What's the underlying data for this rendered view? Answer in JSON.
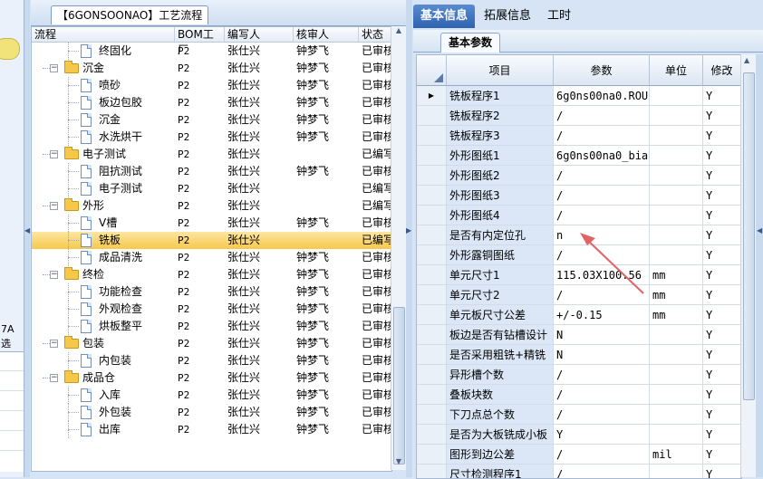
{
  "left_strip": {
    "labels": [
      "7A",
      "选"
    ]
  },
  "tree_panel": {
    "tab_title": "【6GONSOONAO】工艺流程",
    "columns": [
      "流程",
      "BOM工厂",
      "编写人",
      "核审人",
      "状态"
    ],
    "rows": [
      {
        "level": 2,
        "kind": "item",
        "name": "终固化",
        "bom": "P2",
        "writer": "张仕兴",
        "reviewer": "钟梦飞",
        "status": "已审核"
      },
      {
        "level": 1,
        "kind": "folder",
        "name": "沉金",
        "bom": "P2",
        "writer": "张仕兴",
        "reviewer": "钟梦飞",
        "status": "已审核"
      },
      {
        "level": 2,
        "kind": "item",
        "name": "喷砂",
        "bom": "P2",
        "writer": "张仕兴",
        "reviewer": "钟梦飞",
        "status": "已审核"
      },
      {
        "level": 2,
        "kind": "item",
        "name": "板边包胶",
        "bom": "P2",
        "writer": "张仕兴",
        "reviewer": "钟梦飞",
        "status": "已审核"
      },
      {
        "level": 2,
        "kind": "item",
        "name": "沉金",
        "bom": "P2",
        "writer": "张仕兴",
        "reviewer": "钟梦飞",
        "status": "已审核"
      },
      {
        "level": 2,
        "kind": "item",
        "name": "水洗烘干",
        "bom": "P2",
        "writer": "张仕兴",
        "reviewer": "钟梦飞",
        "status": "已审核"
      },
      {
        "level": 1,
        "kind": "folder",
        "name": "电子测试",
        "bom": "P2",
        "writer": "张仕兴",
        "reviewer": "",
        "status": "已编写"
      },
      {
        "level": 2,
        "kind": "item",
        "name": "阻抗测试",
        "bom": "P2",
        "writer": "张仕兴",
        "reviewer": "钟梦飞",
        "status": "已审核"
      },
      {
        "level": 2,
        "kind": "item",
        "name": "电子测试",
        "bom": "P2",
        "writer": "张仕兴",
        "reviewer": "",
        "status": "已编写"
      },
      {
        "level": 1,
        "kind": "folder",
        "name": "外形",
        "bom": "P2",
        "writer": "张仕兴",
        "reviewer": "",
        "status": "已编写"
      },
      {
        "level": 2,
        "kind": "item",
        "name": "V槽",
        "bom": "P2",
        "writer": "张仕兴",
        "reviewer": "钟梦飞",
        "status": "已审核"
      },
      {
        "level": 2,
        "kind": "item",
        "name": "铣板",
        "bom": "P2",
        "writer": "张仕兴",
        "reviewer": "",
        "status": "已编写",
        "selected": true
      },
      {
        "level": 2,
        "kind": "item",
        "name": "成品清洗",
        "bom": "P2",
        "writer": "张仕兴",
        "reviewer": "钟梦飞",
        "status": "已审核"
      },
      {
        "level": 1,
        "kind": "folder",
        "name": "终检",
        "bom": "P2",
        "writer": "张仕兴",
        "reviewer": "钟梦飞",
        "status": "已审核"
      },
      {
        "level": 2,
        "kind": "item",
        "name": "功能检查",
        "bom": "P2",
        "writer": "张仕兴",
        "reviewer": "钟梦飞",
        "status": "已审核"
      },
      {
        "level": 2,
        "kind": "item",
        "name": "外观检查",
        "bom": "P2",
        "writer": "张仕兴",
        "reviewer": "钟梦飞",
        "status": "已审核"
      },
      {
        "level": 2,
        "kind": "item",
        "name": "烘板整平",
        "bom": "P2",
        "writer": "张仕兴",
        "reviewer": "钟梦飞",
        "status": "已审核"
      },
      {
        "level": 1,
        "kind": "folder",
        "name": "包装",
        "bom": "P2",
        "writer": "张仕兴",
        "reviewer": "钟梦飞",
        "status": "已审核"
      },
      {
        "level": 2,
        "kind": "item",
        "name": "内包装",
        "bom": "P2",
        "writer": "张仕兴",
        "reviewer": "钟梦飞",
        "status": "已审核"
      },
      {
        "level": 1,
        "kind": "folder",
        "name": "成品仓",
        "bom": "P2",
        "writer": "张仕兴",
        "reviewer": "钟梦飞",
        "status": "已审核"
      },
      {
        "level": 2,
        "kind": "item",
        "name": "入库",
        "bom": "P2",
        "writer": "张仕兴",
        "reviewer": "钟梦飞",
        "status": "已审核"
      },
      {
        "level": 2,
        "kind": "item",
        "name": "外包装",
        "bom": "P2",
        "writer": "张仕兴",
        "reviewer": "钟梦飞",
        "status": "已审核"
      },
      {
        "level": 2,
        "kind": "item",
        "name": "出库",
        "bom": "P2",
        "writer": "张仕兴",
        "reviewer": "钟梦飞",
        "status": "已审核"
      }
    ]
  },
  "right_panel": {
    "tabs": [
      "基本信息",
      "拓展信息",
      "工时"
    ],
    "active_tab": "基本信息",
    "sub_tab": "基本参数",
    "columns": [
      "项目",
      "参数",
      "单位",
      "修改"
    ],
    "rows": [
      {
        "item": "铣板程序1",
        "param": "6g0ns00na0.ROU",
        "unit": "",
        "modify": "Y",
        "current": true
      },
      {
        "item": "铣板程序2",
        "param": "/",
        "unit": "",
        "modify": "Y"
      },
      {
        "item": "铣板程序3",
        "param": "/",
        "unit": "",
        "modify": "Y"
      },
      {
        "item": "外形图纸1",
        "param": "6g0ns00na0_bia...",
        "unit": "",
        "modify": "Y"
      },
      {
        "item": "外形图纸2",
        "param": "/",
        "unit": "",
        "modify": "Y"
      },
      {
        "item": "外形图纸3",
        "param": "/",
        "unit": "",
        "modify": "Y"
      },
      {
        "item": "外形图纸4",
        "param": "/",
        "unit": "",
        "modify": "Y"
      },
      {
        "item": "是否有内定位孔",
        "param": "n",
        "unit": "",
        "modify": "Y"
      },
      {
        "item": "外形露铜图纸",
        "param": "/",
        "unit": "",
        "modify": "Y"
      },
      {
        "item": "单元尺寸1",
        "param": "115.03X100.56",
        "unit": "mm",
        "modify": "Y"
      },
      {
        "item": "单元尺寸2",
        "param": "/",
        "unit": "mm",
        "modify": "Y"
      },
      {
        "item": "单元板尺寸公差",
        "param": "+/-0.15",
        "unit": "mm",
        "modify": "Y"
      },
      {
        "item": "板边是否有钻槽设计",
        "param": "N",
        "unit": "",
        "modify": "Y"
      },
      {
        "item": "是否采用粗铣+精铣",
        "param": "N",
        "unit": "",
        "modify": "Y"
      },
      {
        "item": "异形槽个数",
        "param": "/",
        "unit": "",
        "modify": "Y"
      },
      {
        "item": "叠板块数",
        "param": "/",
        "unit": "",
        "modify": "Y"
      },
      {
        "item": "下刀点总个数",
        "param": "/",
        "unit": "",
        "modify": "Y"
      },
      {
        "item": "是否为大板铣成小板",
        "param": "Y",
        "unit": "",
        "modify": "Y"
      },
      {
        "item": "图形到边公差",
        "param": "/",
        "unit": "mil",
        "modify": "Y"
      },
      {
        "item": "尺寸检测程序1",
        "param": "/",
        "unit": "",
        "modify": "Y"
      }
    ]
  },
  "colors": {
    "selection": "#f6c94f",
    "active_tab": "#2f63b0",
    "annotation_arrow": "#e06464"
  }
}
